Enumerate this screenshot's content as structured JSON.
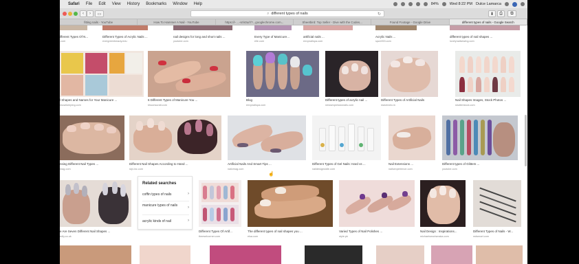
{
  "menubar": {
    "app": "Safari",
    "items": [
      "File",
      "Edit",
      "View",
      "History",
      "Bookmarks",
      "Window",
      "Help"
    ],
    "battery": "84%",
    "clock": "Wed 8:22 PM",
    "user": "Dulce Lamarca"
  },
  "toolbar": {
    "back": "‹",
    "forward": "›",
    "sidebar": "▭",
    "address": "different types of nails",
    "reload": "↻",
    "download": "⬇",
    "share": "⎙",
    "newtab": "⧉"
  },
  "tabs": [
    "fitting nails - YouTube",
    "How To Hammer A Nail - YouTube",
    "https://i- ...-sr/s0u/r/?...googlechrome.com...",
    "Sheetbird: Top Seller - Dive with the Codes...",
    "Found Footage - Google Drive",
    "different types of nails - Google Search"
  ],
  "row0": [
    {
      "title": "ifferent Types Of N...",
      "source": ".com"
    },
    {
      "title": "Different Types of Acrylic Nails ...",
      "source": "evergreenbeauty.edu"
    },
    {
      "title": "nail designs for long and short nails ...",
      "source": "youtube.com"
    },
    {
      "title": "Every Type of Manicure...",
      "source": "elle.com"
    },
    {
      "title": "artificial nails ...",
      "source": "envynailspa.com"
    },
    {
      "title": "Acrylic Nails ...",
      "source": "spa1053.com"
    },
    {
      "title": "different types of nail shapes ...",
      "source": "lovelynailsewing.com"
    }
  ],
  "row1": [
    {
      "title": "l Shapes and Names for Your Manicure ...",
      "source": "musekeeping.com"
    },
    {
      "title": "6 Different Types of Manicure You ...",
      "source": "khuonsurati.com"
    },
    {
      "title": "Blog",
      "source": "envynailspa.com"
    },
    {
      "title": "Different types of acrylic nail ...",
      "source": "newsexpressionails.com"
    },
    {
      "title": "Different Types of Artificial Nails",
      "source": "mavendro.in"
    },
    {
      "title": "Nail Shapes Images, Stock Photos ...",
      "source": "shutterstock.com"
    }
  ],
  "row2": [
    {
      "title": "nsing Different Nail Types ...",
      "source": "mag.com"
    },
    {
      "title": "Different Nail Shapes According to Hand ...",
      "source": "styl-inc.com"
    },
    {
      "title": "Artificial Nails And Smart Tips ...",
      "source": "nailzmag.com"
    },
    {
      "title": "Different Types of Gel Nails: Hard vs ...",
      "source": "naildesignsidle.com"
    },
    {
      "title": "Nail Extensions ...",
      "source": "nailsexperience.com"
    },
    {
      "title": "Different types of Glitters ...",
      "source": "youtube.com"
    }
  ],
  "row3": [
    {
      "title": "e Are Seven Different Nail Shapes ...",
      "source": "edly.co.uk"
    },
    {
      "title": "Different Types Of Artif...",
      "source": "theeselcorner.com"
    },
    {
      "title": "The different types of nail shapes you ...",
      "source": "elsa.com"
    },
    {
      "title": "Varied Types of Nail Polishes ...",
      "source": "style.pk"
    },
    {
      "title": "Nail Design : Inspirations...",
      "source": "michaelsmorismaka.com"
    },
    {
      "title": "Different Types of Nails - W...",
      "source": "mdsmart.com"
    }
  ],
  "related": {
    "heading": "Related searches",
    "items": [
      "coffin types of nails",
      "manicure types of nails",
      "acrylic kinds of nail"
    ]
  }
}
